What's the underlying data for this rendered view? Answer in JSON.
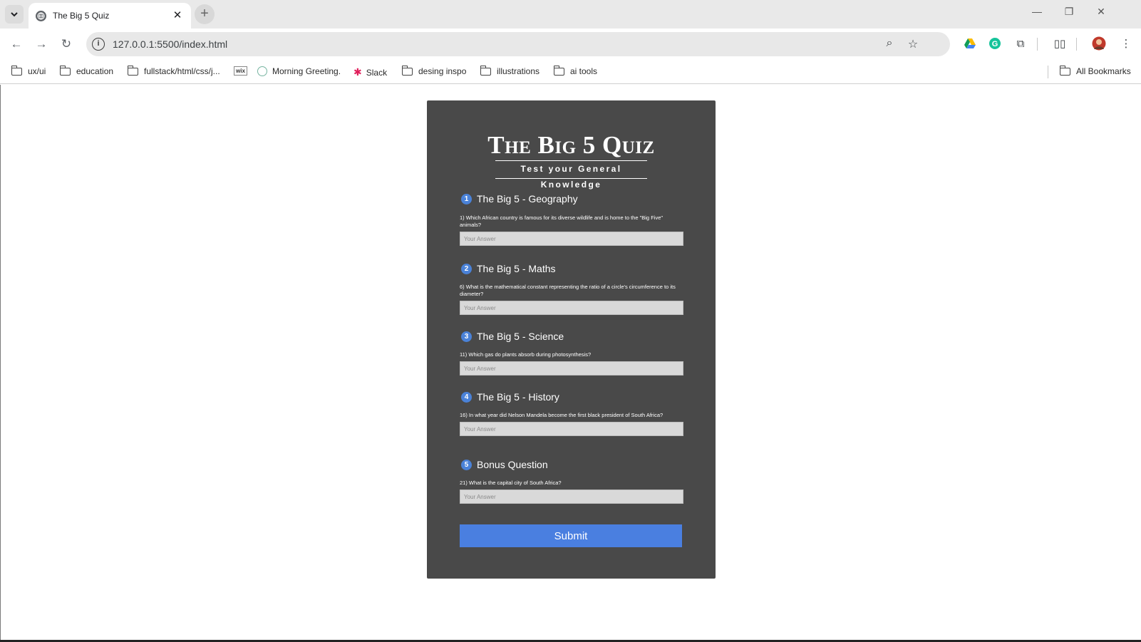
{
  "browser": {
    "tab_title": "The Big 5 Quiz",
    "tab_close": "✕",
    "new_tab": "+",
    "url": "127.0.0.1:5500/index.html",
    "bookmarks": [
      {
        "label": "ux/ui",
        "icon": "folder-icon"
      },
      {
        "label": "education",
        "icon": "folder-icon"
      },
      {
        "label": "fullstack/html/css/j...",
        "icon": "folder-icon"
      },
      {
        "label": "wix",
        "icon": "wix-icon"
      },
      {
        "label": "Morning Greeting.",
        "icon": "chatgpt-icon"
      },
      {
        "label": "Slack",
        "icon": "slack-icon"
      },
      {
        "label": "desing inspo",
        "icon": "folder-icon"
      },
      {
        "label": "illustrations",
        "icon": "folder-icon"
      },
      {
        "label": "ai tools",
        "icon": "folder-icon"
      }
    ],
    "all_bookmarks": "All Bookmarks"
  },
  "quiz": {
    "title": "The Big 5 Quiz",
    "subtitle": "Test your General Knowledge",
    "placeholder": "Your Answer",
    "sections": [
      {
        "num": "1",
        "title": "The Big 5 - Geography",
        "question": "1) Which African country is famous for its diverse wildlife and is home to the \"Big Five\" animals?"
      },
      {
        "num": "2",
        "title": "The Big 5 - Maths",
        "question": "6) What is the mathematical constant representing the ratio of a circle's circumference to its diameter?"
      },
      {
        "num": "3",
        "title": "The Big 5 - Science",
        "question": "11) Which gas do plants absorb during photosynthesis?"
      },
      {
        "num": "4",
        "title": "The Big 5 - History",
        "question": "16) In what year did Nelson Mandela become the first black president of South Africa?"
      },
      {
        "num": "5",
        "title": "Bonus Question",
        "question": "21) What is the capital city of South Africa?"
      }
    ],
    "submit_label": "Submit"
  },
  "colors": {
    "card_bg": "#494949",
    "accent": "#4a7fe0"
  }
}
